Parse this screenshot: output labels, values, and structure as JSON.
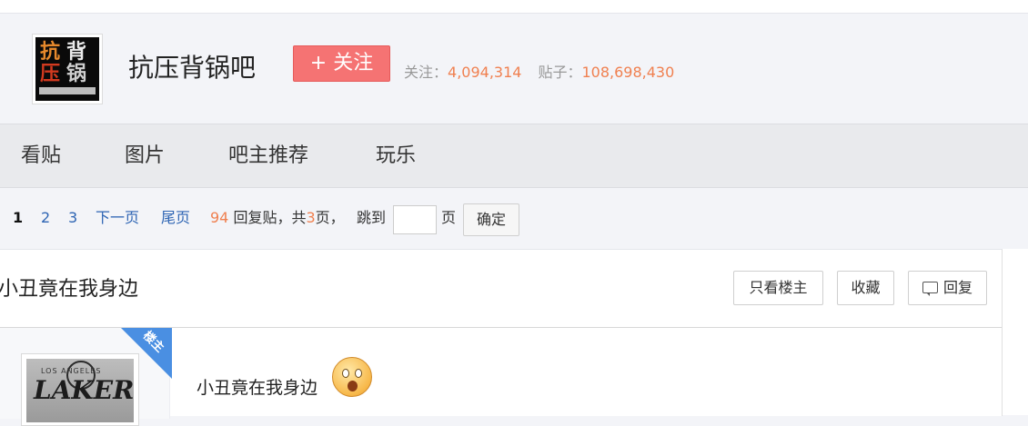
{
  "forum": {
    "logo_chars": [
      "抗",
      "背",
      "压",
      "锅"
    ],
    "name": "抗压背锅吧",
    "follow_label": "+ 关注",
    "followers_label": "关注：",
    "followers_value": "4,094,314",
    "posts_label": "贴子：",
    "posts_value": "108,698,430"
  },
  "nav": {
    "items": [
      "看贴",
      "图片",
      "吧主推荐",
      "玩乐"
    ]
  },
  "pager": {
    "current": "1",
    "pages": [
      "2",
      "3"
    ],
    "next": "下一页",
    "last": "尾页",
    "reply_count": "94",
    "reply_text": "回复贴，共",
    "total_pages": "3",
    "pages_suffix": "页，",
    "jump_label": "跳到",
    "jump_value": "",
    "page_label": "页",
    "confirm": "确定"
  },
  "thread": {
    "title": "小丑竟在我身边",
    "actions": {
      "only_op": "只看楼主",
      "favorite": "收藏",
      "reply": "回复"
    },
    "op_badge": "楼主",
    "avatar_text": [
      "LOS ANGELES",
      "LAKERS"
    ],
    "content": "小丑竟在我身边",
    "emoji_icon": "surprised-face-icon"
  },
  "colors": {
    "follow_button": "#f57373",
    "stat_number": "#f08050",
    "link": "#2d64b3",
    "op_badge": "#4a8fe2"
  }
}
